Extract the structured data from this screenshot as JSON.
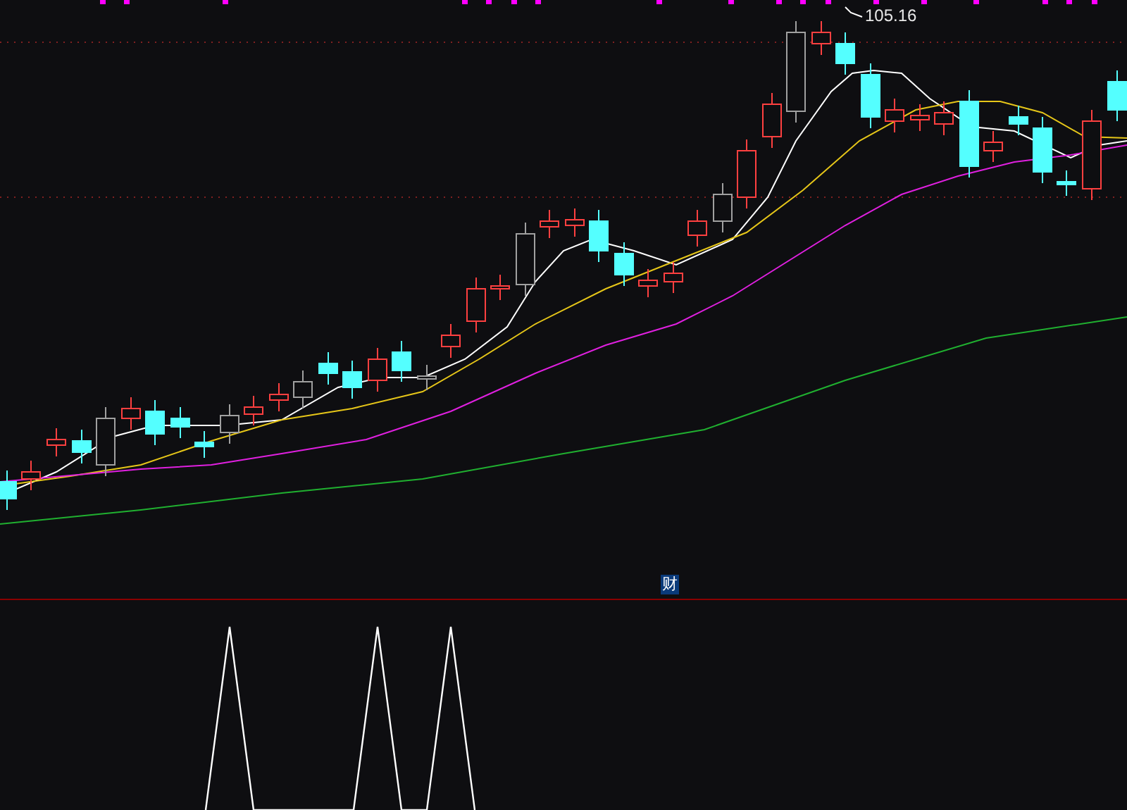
{
  "price_chart": {
    "high_label": "105.16"
  },
  "indicator_panel": {
    "title": "财"
  }
}
